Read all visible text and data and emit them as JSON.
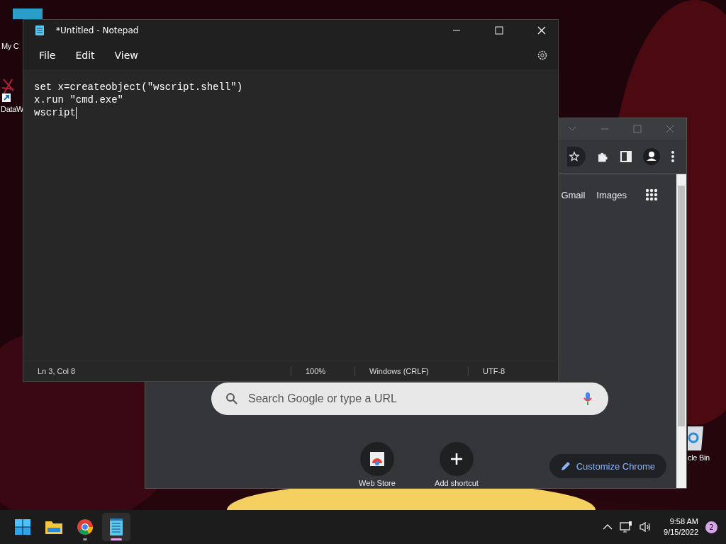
{
  "desktop_icons": [
    {
      "label": "My C",
      "kind": "computer"
    },
    {
      "label": "DataW",
      "kind": "shortcut"
    },
    {
      "label": "cle Bin",
      "kind": "recycle"
    }
  ],
  "browser": {
    "toolbar_icons": [
      {
        "kind": "star"
      },
      {
        "kind": "extensions"
      },
      {
        "kind": "sidepanel"
      },
      {
        "kind": "profile"
      },
      {
        "kind": "more"
      }
    ],
    "links": [
      "Gmail",
      "Images"
    ],
    "search": {
      "placeholder": "Search Google or type a URL"
    },
    "shortcuts": [
      {
        "label": "Web Store",
        "kind": "store"
      },
      {
        "label": "Add shortcut",
        "kind": "add"
      }
    ],
    "customize_button": "Customize Chrome"
  },
  "notepad": {
    "title": "*Untitled - Notepad",
    "menu": [
      "File",
      "Edit",
      "View"
    ],
    "lines": [
      "set x=createobject(\"wscript.shell\")",
      "x.run \"cmd.exe\"",
      "wscript"
    ],
    "status_bar": [
      "Ln 3, Col 8",
      "100%",
      "Windows (CRLF)",
      "UTF-8"
    ]
  },
  "taskbar": {
    "apps": [
      {
        "kind": "start",
        "running": false,
        "selected": false
      },
      {
        "kind": "explorer",
        "running": false,
        "selected": false
      },
      {
        "kind": "chrome",
        "running": true,
        "selected": false
      },
      {
        "kind": "notepad",
        "running": true,
        "selected": true
      }
    ],
    "time": "9:58 AM",
    "date": "9/15/2022",
    "notifications": "2"
  }
}
